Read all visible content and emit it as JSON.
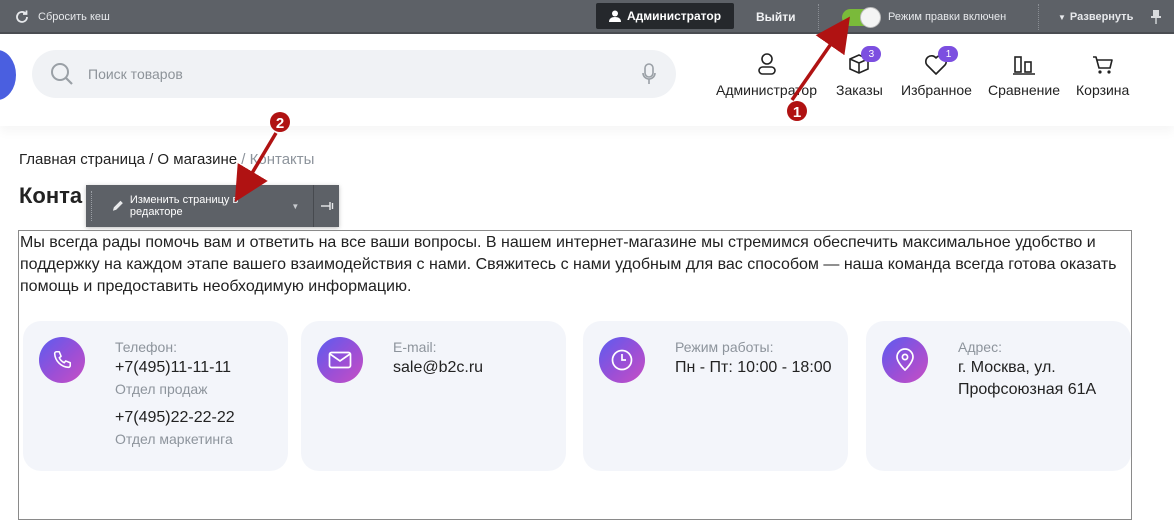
{
  "admin_bar": {
    "clear_cache": "Сбросить кеш",
    "admin_button": "Администратор",
    "logout": "Выйти",
    "edit_mode": "Режим правки включен",
    "expand": "Развернуть"
  },
  "header": {
    "search_placeholder": "Поиск товаров",
    "nav": [
      {
        "label": "Администратор",
        "icon": "user-icon"
      },
      {
        "label": "Заказы",
        "icon": "box-icon",
        "badge": "3"
      },
      {
        "label": "Избранное",
        "icon": "heart-icon",
        "badge": "1"
      },
      {
        "label": "Сравнение",
        "icon": "compare-icon"
      },
      {
        "label": "Корзина",
        "icon": "cart-icon"
      }
    ]
  },
  "breadcrumb": {
    "home": "Главная страница",
    "about": "/ О магазине",
    "current": "/ Контакты"
  },
  "page": {
    "title": "Конта",
    "edit_button": "Изменить страницу в редакторе",
    "intro": "Мы всегда рады помочь вам и ответить на все ваши вопросы. В нашем интернет-магазине мы стремимся обеспечить максимальное удобство и поддержку на каждом этапе вашего взаимодействия с нами. Свяжитесь с нами удобным для вас способом — наша команда всегда готова оказать помощь и предоставить необходимую информацию."
  },
  "contacts": {
    "phone": {
      "label": "Телефон:",
      "value1": "+7(495)11-11-11",
      "sub1": "Отдел продаж",
      "value2": "+7(495)22-22-22",
      "sub2": "Отдел маркетинга"
    },
    "email": {
      "label": "E-mail:",
      "value": "sale@b2c.ru"
    },
    "hours": {
      "label": "Режим работы:",
      "value": "Пн - Пт: 10:00 - 18:00"
    },
    "address": {
      "label": "Адрес:",
      "line1": "г. Москва, ул.",
      "line2": "Профсоюзная 61А"
    }
  },
  "annotations": {
    "marker1": "1",
    "marker2": "2"
  },
  "colors": {
    "accent": "#7c4fe0",
    "admin_bar": "#5d6167",
    "toggle_on": "#7aba3a",
    "annotation": "#b01212"
  }
}
